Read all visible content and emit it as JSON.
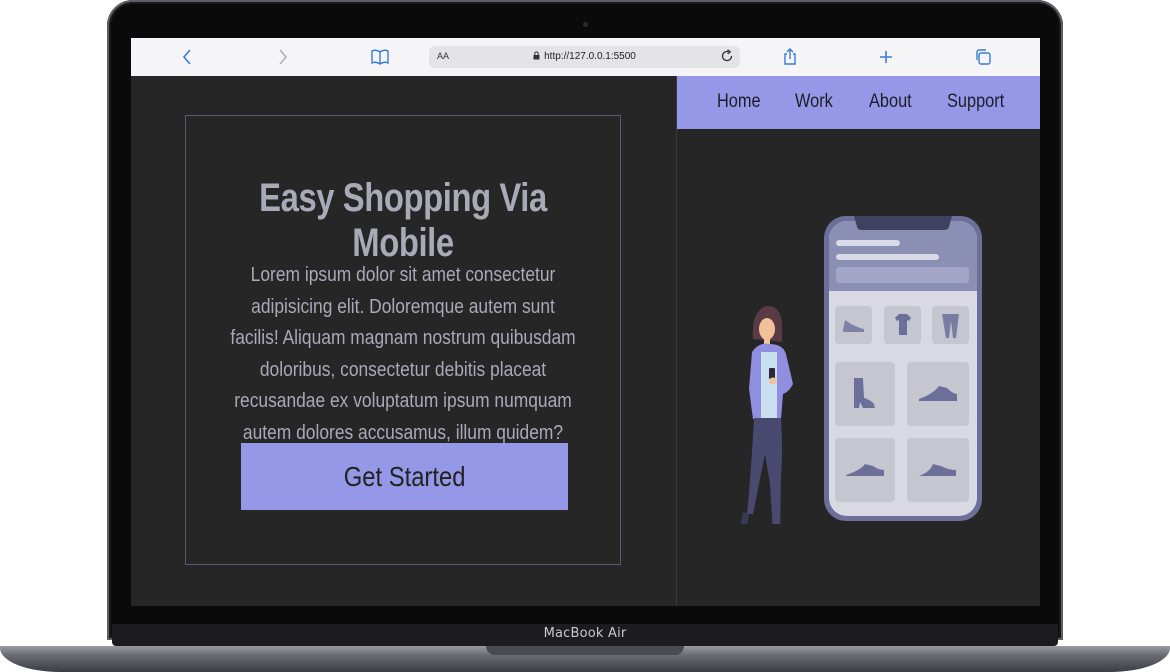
{
  "device": {
    "brand_label": "MacBook Air"
  },
  "browser": {
    "address_aa": "AA",
    "url": "http://127.0.0.1:5500",
    "icons": [
      "back-icon",
      "forward-icon",
      "book-icon",
      "lock-icon",
      "reload-icon",
      "share-icon",
      "plus-icon",
      "tabs-icon"
    ]
  },
  "nav": {
    "items": [
      {
        "label": "Home"
      },
      {
        "label": "Work"
      },
      {
        "label": "About"
      },
      {
        "label": "Support"
      }
    ]
  },
  "hero": {
    "title": "Easy Shopping Via Mobile",
    "body": "Lorem ipsum dolor sit amet consectetur adipisicing elit. Doloremque autem sunt facilis! Aliquam magnam nostrum quibusdam doloribus, consectetur debitis placeat recusandae ex voluptatum ipsum numquam autem dolores accusamus, illum quidem?",
    "cta_label": "Get Started"
  },
  "colors": {
    "accent": "#9598e6",
    "background": "#262626",
    "text_muted": "#a9a9b8"
  }
}
